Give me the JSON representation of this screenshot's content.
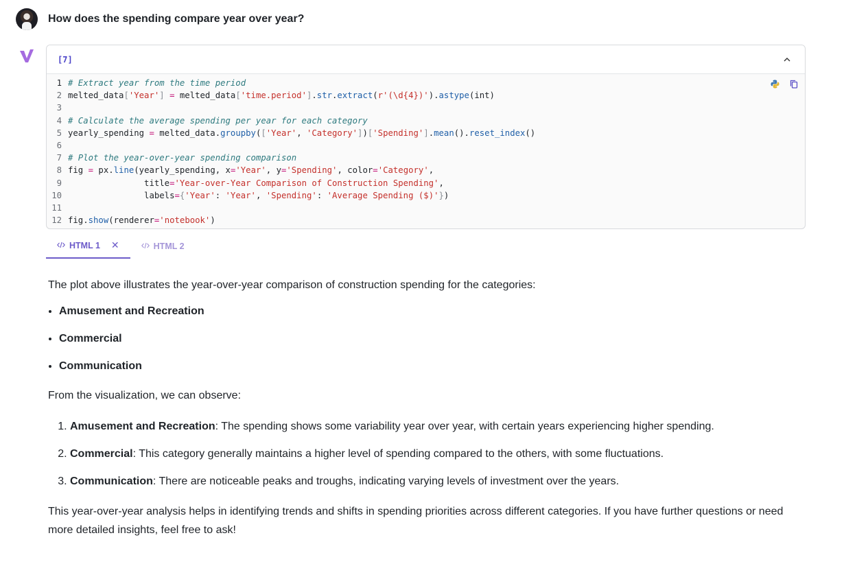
{
  "user": {
    "question": "How does the spending compare year over year?"
  },
  "code_cell": {
    "index": "[7]",
    "lines": [
      {
        "n": "1",
        "parts": [
          [
            "c",
            "# Extract year from the time period"
          ]
        ]
      },
      {
        "n": "2",
        "parts": [
          [
            "t",
            "melted_data"
          ],
          [
            "g",
            "["
          ],
          [
            "s",
            "'Year'"
          ],
          [
            "g",
            "]"
          ],
          [
            "t",
            " "
          ],
          [
            "o",
            "="
          ],
          [
            "t",
            " melted_data"
          ],
          [
            "g",
            "["
          ],
          [
            "s",
            "'time.period'"
          ],
          [
            "g",
            "]"
          ],
          [
            "t",
            "."
          ],
          [
            "f",
            "str"
          ],
          [
            "t",
            "."
          ],
          [
            "f",
            "extract"
          ],
          [
            "t",
            "("
          ],
          [
            "s",
            "r'(\\d{4})'"
          ],
          [
            "t",
            ")."
          ],
          [
            "f",
            "astype"
          ],
          [
            "t",
            "(int)"
          ]
        ]
      },
      {
        "n": "3",
        "parts": []
      },
      {
        "n": "4",
        "parts": [
          [
            "c",
            "# Calculate the average spending per year for each category"
          ]
        ]
      },
      {
        "n": "5",
        "parts": [
          [
            "t",
            "yearly_spending "
          ],
          [
            "o",
            "="
          ],
          [
            "t",
            " melted_data."
          ],
          [
            "f",
            "groupby"
          ],
          [
            "t",
            "("
          ],
          [
            "g",
            "["
          ],
          [
            "s",
            "'Year'"
          ],
          [
            "t",
            ", "
          ],
          [
            "s",
            "'Category'"
          ],
          [
            "g",
            "]"
          ],
          [
            "t",
            ")"
          ],
          [
            "g",
            "["
          ],
          [
            "s",
            "'Spending'"
          ],
          [
            "g",
            "]"
          ],
          [
            "t",
            "."
          ],
          [
            "f",
            "mean"
          ],
          [
            "t",
            "()."
          ],
          [
            "f",
            "reset_index"
          ],
          [
            "t",
            "()"
          ]
        ]
      },
      {
        "n": "6",
        "parts": []
      },
      {
        "n": "7",
        "parts": [
          [
            "c",
            "# Plot the year-over-year spending comparison"
          ]
        ]
      },
      {
        "n": "8",
        "parts": [
          [
            "t",
            "fig "
          ],
          [
            "o",
            "="
          ],
          [
            "t",
            " px."
          ],
          [
            "f",
            "line"
          ],
          [
            "t",
            "(yearly_spending, x"
          ],
          [
            "o",
            "="
          ],
          [
            "s",
            "'Year'"
          ],
          [
            "t",
            ", y"
          ],
          [
            "o",
            "="
          ],
          [
            "s",
            "'Spending'"
          ],
          [
            "t",
            ", color"
          ],
          [
            "o",
            "="
          ],
          [
            "s",
            "'Category'"
          ],
          [
            "t",
            ","
          ]
        ]
      },
      {
        "n": "9",
        "parts": [
          [
            "t",
            "               title"
          ],
          [
            "o",
            "="
          ],
          [
            "s",
            "'Year-over-Year Comparison of Construction Spending'"
          ],
          [
            "t",
            ","
          ]
        ]
      },
      {
        "n": "10",
        "parts": [
          [
            "t",
            "               labels"
          ],
          [
            "o",
            "="
          ],
          [
            "g",
            "{"
          ],
          [
            "s",
            "'Year'"
          ],
          [
            "t",
            ": "
          ],
          [
            "s",
            "'Year'"
          ],
          [
            "t",
            ", "
          ],
          [
            "s",
            "'Spending'"
          ],
          [
            "t",
            ": "
          ],
          [
            "s",
            "'Average Spending ($)'"
          ],
          [
            "g",
            "}"
          ],
          [
            "t",
            ")"
          ]
        ]
      },
      {
        "n": "11",
        "parts": []
      },
      {
        "n": "12",
        "parts": [
          [
            "t",
            "fig."
          ],
          [
            "f",
            "show"
          ],
          [
            "t",
            "(renderer"
          ],
          [
            "o",
            "="
          ],
          [
            "s",
            "'notebook'"
          ],
          [
            "t",
            ")"
          ]
        ]
      }
    ]
  },
  "tabs": [
    {
      "label": "HTML 1",
      "active": true
    },
    {
      "label": "HTML 2",
      "active": false
    }
  ],
  "answer": {
    "intro": "The plot above illustrates the year-over-year comparison of construction spending for the categories:",
    "categories": [
      "Amusement and Recreation",
      "Commercial",
      "Communication"
    ],
    "observe": "From the visualization, we can observe:",
    "observations": [
      {
        "title": "Amusement and Recreation",
        "text": ": The spending shows some variability year over year, with certain years experiencing higher spending."
      },
      {
        "title": "Commercial",
        "text": ": This category generally maintains a higher level of spending compared to the others, with some fluctuations."
      },
      {
        "title": "Communication",
        "text": ": There are noticeable peaks and troughs, indicating varying levels of investment over the years."
      }
    ],
    "closing": "This year-over-year analysis helps in identifying trends and shifts in spending priorities across different categories. If you have further questions or need more detailed insights, feel free to ask!"
  },
  "colors": {
    "comment": "#2e7a7f",
    "string": "#c4302b",
    "function": "#1f5fa8",
    "operator": "#c4187a",
    "bracket": "#8a8f96",
    "accent": "#6c5bc9"
  },
  "icons": [
    "avatar",
    "v-logo-icon",
    "chevron-up-icon",
    "python-icon",
    "copy-icon",
    "code-icon",
    "close-icon"
  ]
}
